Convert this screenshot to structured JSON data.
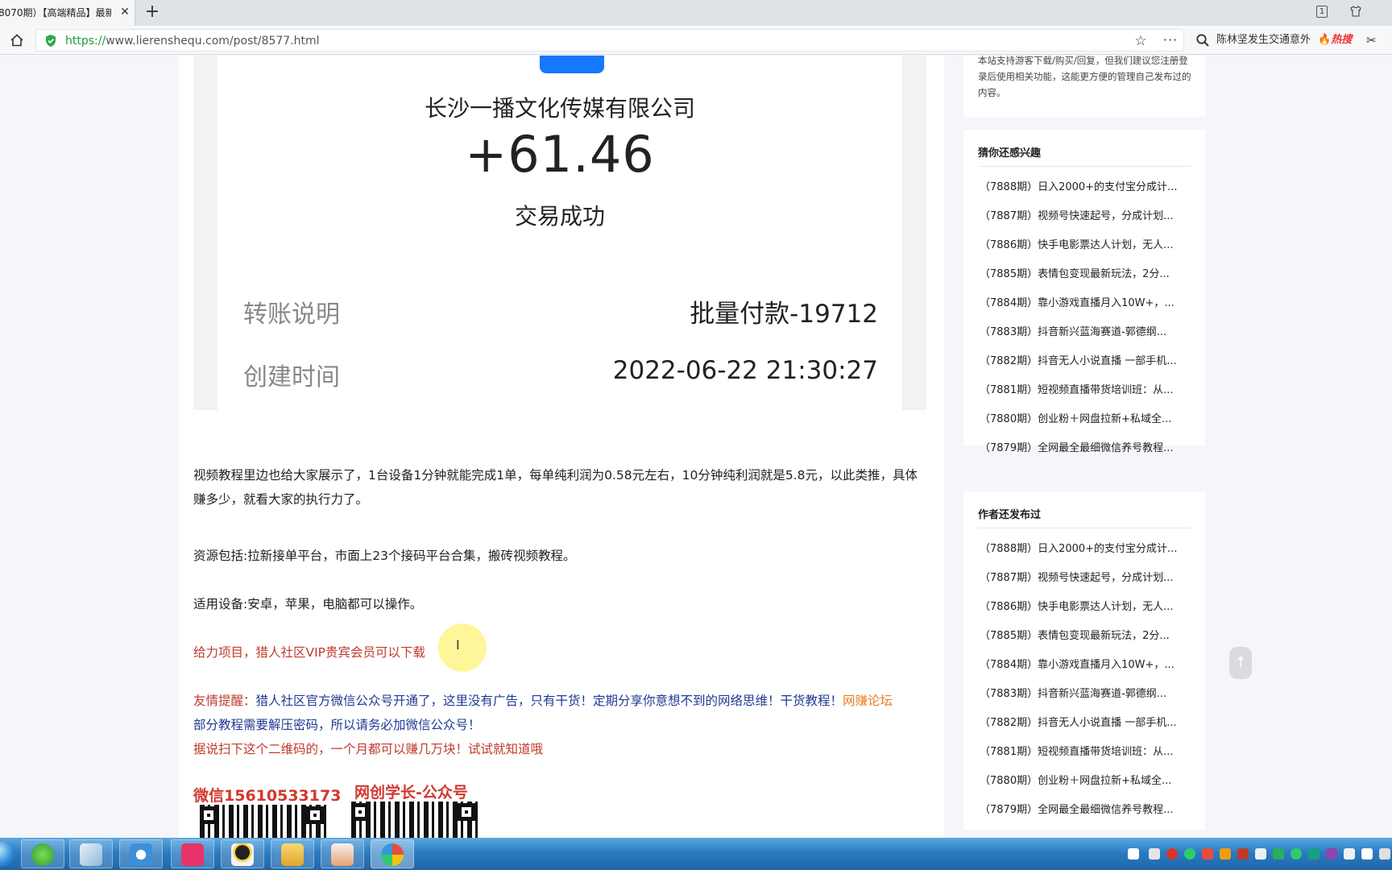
{
  "browser": {
    "tab_title": "8070期）【高端精品】最新",
    "url_scheme": "https://",
    "url_rest": "www.lierenshequ.com/post/8577.html",
    "search_text": "陈林坚发生交通意外",
    "hot_badge": "热搜",
    "window_badge": "1"
  },
  "receipt": {
    "company": "长沙一播文化传媒有限公司",
    "amount": "+61.46",
    "status": "交易成功",
    "rows": [
      {
        "label": "转账说明",
        "value": "批量付款-19712"
      },
      {
        "label": "创建时间",
        "value": "2022-06-22 21:30:27"
      }
    ]
  },
  "article": {
    "p1": "视频教程里边也给大家展示了，1台设备1分钟就能完成1单，每单纯利润为0.58元左右，10分钟纯利润就是5.8元，以此类推，具体赚多少，就看大家的执行力了。",
    "p2": "资源包括:拉新接单平台，市面上23个接码平台合集，搬砖视频教程。",
    "p3": "适用设备:安卓，苹果，电脑都可以操作。",
    "p4": "给力项目，猎人社区VIP贵宾会员可以下载",
    "tip_prefix": "友情提醒：",
    "tip_body": "猎人社区官方微信公众号开通了，这里没有广告，只有干货！定期分享你意想不到的网络思维！干货教程！",
    "tip_link": "网赚论坛",
    "tip_line2": "部分教程需要解压密码，所以请务必加微信公众号！",
    "tip_line3": "据说扫下这个二维码的，一个月都可以赚几万块！试试就知道哦",
    "qr_caption_1": "微信15610533173",
    "qr_caption_2": "网创学长-公众号"
  },
  "sidebar": {
    "notice": "本站支持游客下载/购买/回复，但我们建议您注册登录后使用相关功能，这能更方便的管理自己发布过的内容。",
    "section1_title": "猜你还感兴趣",
    "section1_items": [
      "（7888期）日入2000+的支付宝分成计...",
      "（7887期）视频号快速起号，分成计划...",
      "（7886期）快手电影票达人计划，无人...",
      "（7885期）表情包变现最新玩法，2分...",
      "（7884期）靠小游戏直播月入10W+，...",
      "（7883期）抖音新兴蓝海赛道-郭德纲...",
      "（7882期）抖音无人小说直播 一部手机...",
      "（7881期）短视频直播带货培训班：从...",
      "（7880期）创业粉＋网盘拉新+私域全...",
      "（7879期）全网最全最细微信养号教程..."
    ],
    "section2_title": "作者还发布过",
    "section2_items": [
      "（7888期）日入2000+的支付宝分成计...",
      "（7887期）视频号快速起号，分成计划...",
      "（7886期）快手电影票达人计划，无人...",
      "（7885期）表情包变现最新玩法，2分...",
      "（7884期）靠小游戏直播月入10W+，...",
      "（7883期）抖音新兴蓝海赛道-郭德纲...",
      "（7882期）抖音无人小说直播 一部手机...",
      "（7881期）短视频直播带货培训班：从...",
      "（7880期）创业粉＋网盘拉新+私域全...",
      "（7879期）全网最全最细微信养号教程..."
    ],
    "backtop_arrow": "↑"
  },
  "colors": {
    "accent_red": "#c0392b",
    "accent_navy": "#1f3a93",
    "link_orange": "#e67e22",
    "secure_green": "#1a9c3e"
  },
  "icons": [
    "home-icon",
    "shield-icon",
    "star-icon",
    "more-icon",
    "search-icon",
    "scissors-icon",
    "close-icon",
    "plus-icon",
    "arrow-up-icon"
  ]
}
